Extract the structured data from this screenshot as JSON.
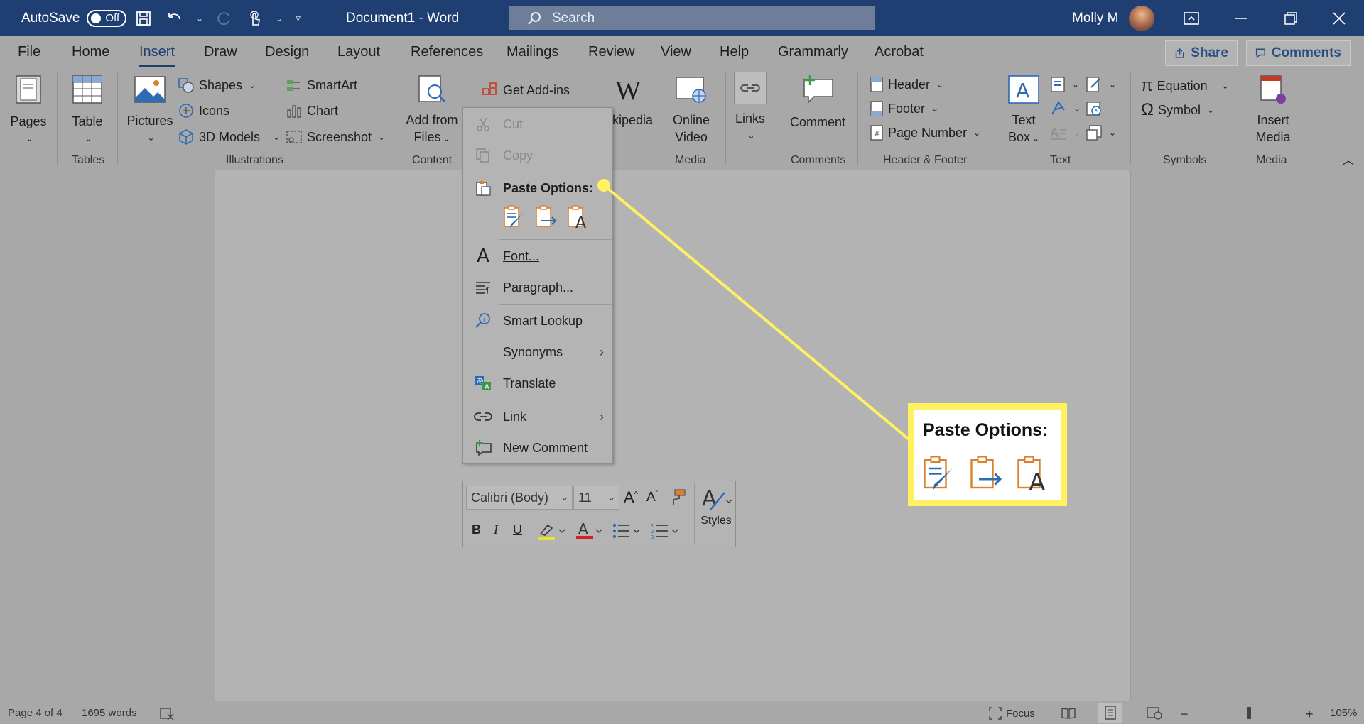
{
  "title_bar": {
    "autosave_label": "AutoSave",
    "autosave_state": "Off",
    "document_title": "Document1  -  Word",
    "search_placeholder": "Search",
    "user_name": "Molly M"
  },
  "menu_tabs": [
    "File",
    "Home",
    "Insert",
    "Draw",
    "Design",
    "Layout",
    "References",
    "Mailings",
    "Review",
    "View",
    "Help",
    "Grammarly",
    "Acrobat"
  ],
  "active_tab": "Insert",
  "share_label": "Share",
  "comments_label": "Comments",
  "ribbon": {
    "pages": "Pages",
    "table": "Table",
    "pictures": "Pictures",
    "shapes": "Shapes",
    "icons": "Icons",
    "models3d": "3D Models",
    "smartart": "SmartArt",
    "chart": "Chart",
    "screenshot": "Screenshot",
    "add_from_files_1": "Add from",
    "add_from_files_2": "Files",
    "get_addins": "Get Add-ins",
    "wikipedia": "kipedia",
    "online_video_1": "Online",
    "online_video_2": "Video",
    "links": "Links",
    "comment": "Comment",
    "header": "Header",
    "footer": "Footer",
    "page_number": "Page Number",
    "text_box_1": "Text",
    "text_box_2": "Box",
    "equation": "Equation",
    "symbol": "Symbol",
    "insert_media_1": "Insert",
    "insert_media_2": "Media",
    "groups": {
      "tables": "Tables",
      "illustrations": "Illustrations",
      "content": "Content",
      "media": "Media",
      "comments": "Comments",
      "header_footer": "Header & Footer",
      "text": "Text",
      "symbols": "Symbols",
      "media2": "Media"
    }
  },
  "context_menu": {
    "cut": "Cut",
    "copy": "Copy",
    "paste_options": "Paste Options:",
    "font": "Font...",
    "paragraph": "Paragraph...",
    "smart_lookup": "Smart Lookup",
    "synonyms": "Synonyms",
    "translate": "Translate",
    "link": "Link",
    "new_comment": "New Comment"
  },
  "mini_toolbar": {
    "font_name": "Calibri (Body)",
    "font_size": "11",
    "styles": "Styles"
  },
  "callout": {
    "title": "Paste Options:"
  },
  "status_bar": {
    "page": "Page 4 of 4",
    "words": "1695 words",
    "focus": "Focus",
    "zoom": "105%"
  },
  "colors": {
    "title_bar": "#1f3f72",
    "highlight_yellow": "#fff160",
    "accent_orange": "#d9822b",
    "accent_blue": "#2e6bb5"
  }
}
